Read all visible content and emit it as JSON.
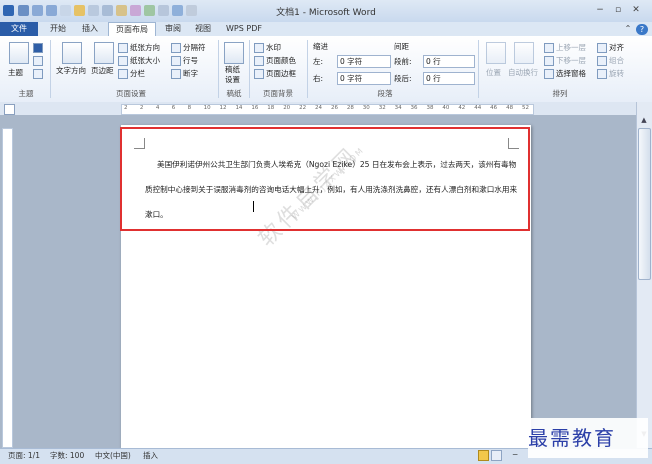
{
  "window": {
    "title": "文档1 - Microsoft Word",
    "min": "−",
    "restore": "▫",
    "close": "✕",
    "help": "?",
    "collapse": "⌃"
  },
  "tabs": [
    "文件",
    "开始",
    "插入",
    "页面布局",
    "审阅",
    "视图",
    "WPS PDF"
  ],
  "ribbon": {
    "themes": {
      "label": "主题",
      "group": "主题"
    },
    "page_setup": {
      "text_direction": "文字方向",
      "margins": "页边距",
      "orientation": "纸张方向",
      "size": "纸张大小",
      "columns": "分栏",
      "breaks": "分隔符",
      "line_numbers": "行号",
      "hyphenation": "断字",
      "group": "页面设置"
    },
    "draft": {
      "label1": "稿纸",
      "label2": "设置",
      "group": "稿纸"
    },
    "background": {
      "watermark": "水印",
      "page_color": "页面颜色",
      "page_border": "页面边框",
      "group": "页面背景"
    },
    "paragraph": {
      "indent": "缩进",
      "spacing": "间距",
      "left_label": "左:",
      "left_value": "0 字符",
      "right_label": "右:",
      "right_value": "0 字符",
      "before_label": "段前:",
      "before_value": "0 行",
      "after_label": "段后:",
      "after_value": "0 行",
      "group": "段落"
    },
    "arrange": {
      "position": "位置",
      "wrap": "自动换行",
      "bring_forward": "上移一层",
      "send_backward": "下移一层",
      "selection_pane": "选择窗格",
      "align": "对齐",
      "group_btn": "组合",
      "rotate": "旋转",
      "group": "排列"
    }
  },
  "ruler": {
    "ticks": [
      "2",
      "2",
      "4",
      "6",
      "8",
      "10",
      "12",
      "14",
      "16",
      "18",
      "20",
      "22",
      "24",
      "26",
      "28",
      "30",
      "32",
      "34",
      "36",
      "38",
      "40",
      "42",
      "44",
      "46",
      "48",
      "52"
    ]
  },
  "document": {
    "paragraph": "美国伊利诺伊州公共卫生部门负责人埃希克（Ngozi Ezike）25 日在发布会上表示，过去两天，该州有毒物质控制中心接到关于误服消毒剂的咨询电话大幅上升，例如，有人用洗涤剂洗鼻腔，还有人漂白剂和漱口水用来漱口。"
  },
  "watermark": {
    "main": "软件自学网",
    "sub": "WWW.RJZXW.COM"
  },
  "status": {
    "page": "页面: 1/1",
    "words": "字数: 100",
    "lang": "中文(中国)",
    "mode": "插入",
    "zoom_minus": "−"
  },
  "brand": "最需教育"
}
